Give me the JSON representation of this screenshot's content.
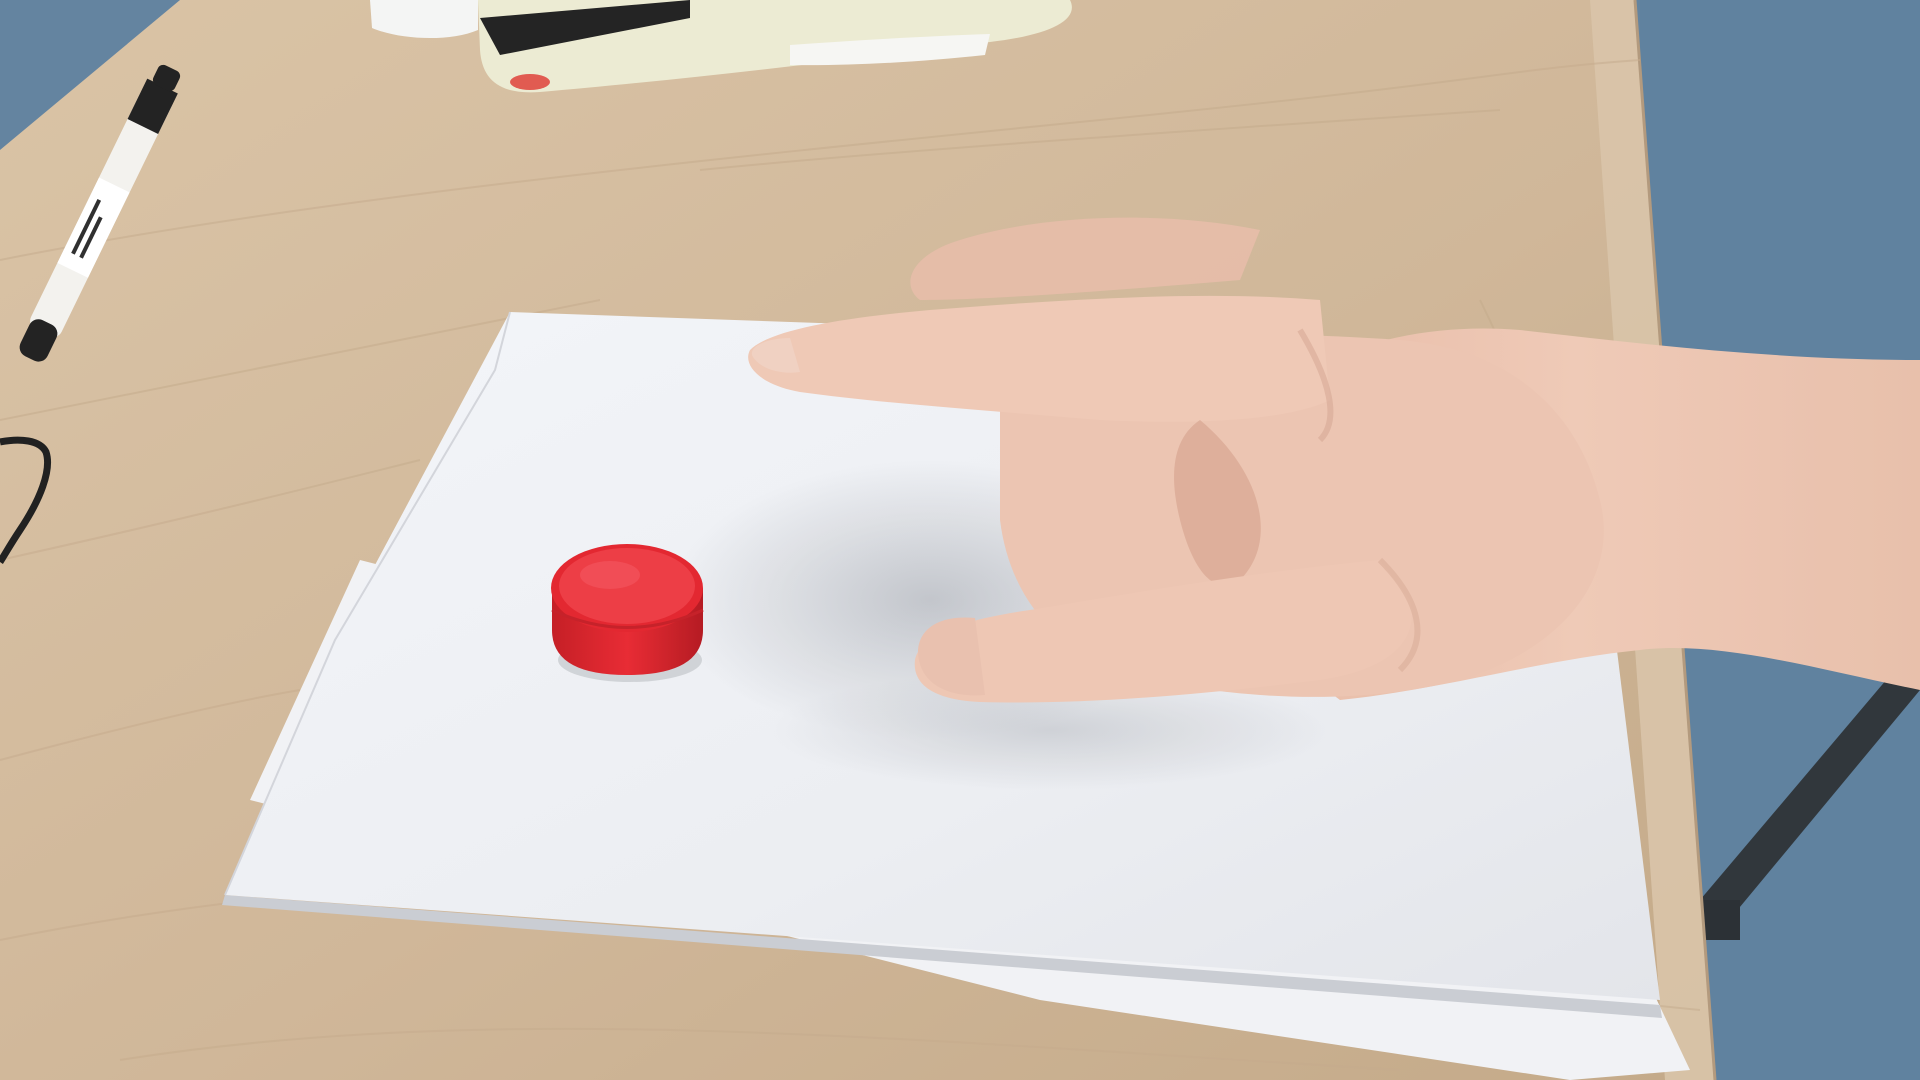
{
  "scene": {
    "colors": {
      "floor": "#5d7f9c",
      "floor_dark": "#3f5e78",
      "table": "#cfb596",
      "table_light": "#dcc6aa",
      "table_edge": "#b69c7d",
      "paper": "#eef0f4",
      "paper_shadow": "#b9bcc2",
      "cap": "#e8262f",
      "cap_top": "#ee3a42",
      "cap_dark": "#a8141c",
      "skin": "#ecc4b0",
      "skin_shade": "#d7a893",
      "marker_body": "#f3f2ee",
      "marker_black": "#1c1c1c",
      "pouch": "#ecebd2",
      "chair_leg": "#2b3136"
    },
    "objects": [
      "wooden-table",
      "paper-stack",
      "red-bottle-cap",
      "hand",
      "whiteboard-marker",
      "pencil-pouch",
      "black-cable",
      "chair-leg"
    ]
  }
}
